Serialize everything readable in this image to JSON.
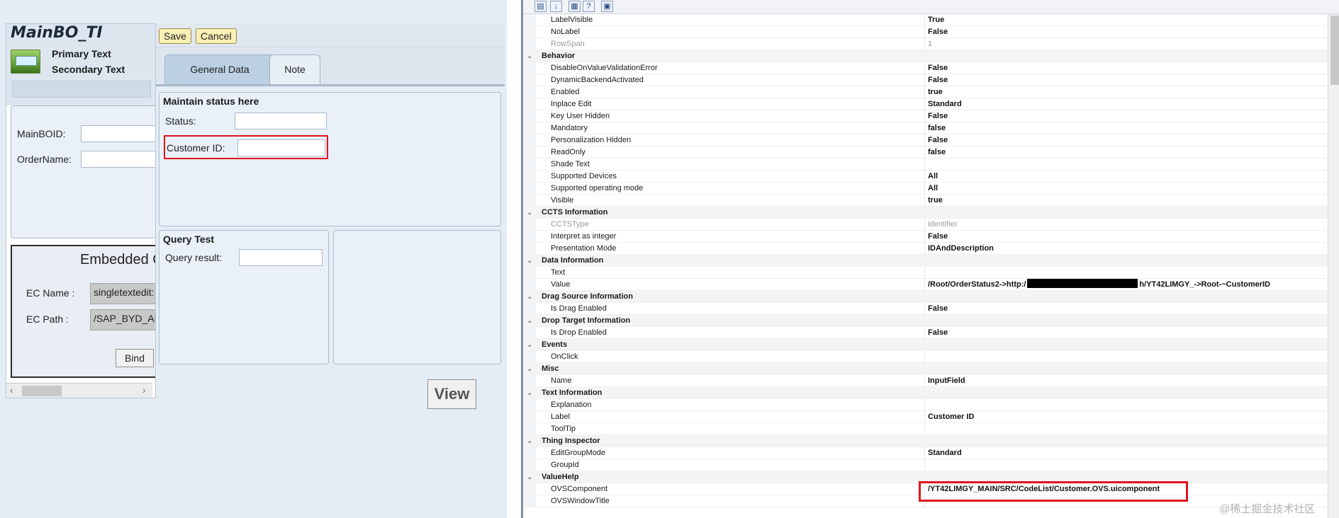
{
  "left_panel": {
    "title": "MainBO_TI",
    "primary_text": "Primary Text",
    "secondary_text": "Secondary Text",
    "fields": [
      {
        "label": "MainBOID:",
        "value": ""
      },
      {
        "label": "OrderName:",
        "value": ""
      }
    ],
    "embedded": {
      "title": "Embedded C",
      "ec_name_label": "EC Name :",
      "ec_name_value": "singletextedit:",
      "ec_path_label": "EC Path :",
      "ec_path_value": "/SAP_BYD_AP",
      "bind_label": "Bind"
    }
  },
  "toolbar": {
    "save_label": "Save",
    "cancel_label": "Cancel"
  },
  "tabs": [
    {
      "label": "General Data",
      "active": true
    },
    {
      "label": "Note",
      "active": false
    }
  ],
  "form": {
    "group1_title": "Maintain status here",
    "status_label": "Status:",
    "status_value": "",
    "customer_id_label": "Customer ID:",
    "customer_id_value": "",
    "query_group_title": "Query Test",
    "query_result_label": "Query result:",
    "query_result_value": "",
    "view_label": "View"
  },
  "property_grid": {
    "rows": [
      {
        "type": "prop",
        "name": "LabelVisible",
        "value": "True"
      },
      {
        "type": "prop",
        "name": "NoLabel",
        "value": "False"
      },
      {
        "type": "prop",
        "name": "RowSpan",
        "value": "1",
        "muted": true
      },
      {
        "type": "category",
        "name": "Behavior"
      },
      {
        "type": "prop",
        "name": "DisableOnValueValidationError",
        "value": "False"
      },
      {
        "type": "prop",
        "name": "DynamicBackendActivated",
        "value": "False"
      },
      {
        "type": "prop",
        "name": "Enabled",
        "value": "true"
      },
      {
        "type": "prop",
        "name": "Inplace Edit",
        "value": "Standard"
      },
      {
        "type": "prop",
        "name": "Key User Hidden",
        "value": "False"
      },
      {
        "type": "prop",
        "name": "Mandatory",
        "value": "false"
      },
      {
        "type": "prop",
        "name": "Personalization Hidden",
        "value": "False"
      },
      {
        "type": "prop",
        "name": "ReadOnly",
        "value": "false"
      },
      {
        "type": "prop",
        "name": "Shade Text",
        "value": ""
      },
      {
        "type": "prop",
        "name": "Supported Devices",
        "value": "All"
      },
      {
        "type": "prop",
        "name": "Supported operating mode",
        "value": "All"
      },
      {
        "type": "prop",
        "name": "Visible",
        "value": "true"
      },
      {
        "type": "category",
        "name": "CCTS Information"
      },
      {
        "type": "prop",
        "name": "CCTSType",
        "value": "identifier",
        "muted": true
      },
      {
        "type": "prop",
        "name": "Interpret as integer",
        "value": "False"
      },
      {
        "type": "prop",
        "name": "Presentation Mode",
        "value": "IDAndDescription"
      },
      {
        "type": "category",
        "name": "Data Information"
      },
      {
        "type": "prop",
        "name": "Text",
        "value": ""
      },
      {
        "type": "prop",
        "name": "Value",
        "value_prefix": "/Root/OrderStatus2->http:/",
        "value_suffix": "h/YT42LIMGY_->Root-~CustomerID",
        "redacted": true
      },
      {
        "type": "category",
        "name": "Drag Source Information"
      },
      {
        "type": "prop",
        "name": "Is Drag Enabled",
        "value": "False"
      },
      {
        "type": "category",
        "name": "Drop Target Information"
      },
      {
        "type": "prop",
        "name": "Is Drop Enabled",
        "value": "False"
      },
      {
        "type": "category",
        "name": "Events"
      },
      {
        "type": "prop",
        "name": "OnClick",
        "value": ""
      },
      {
        "type": "category",
        "name": "Misc"
      },
      {
        "type": "prop",
        "name": "Name",
        "value": "InputField"
      },
      {
        "type": "category",
        "name": "Text Information"
      },
      {
        "type": "prop",
        "name": "Explanation",
        "value": ""
      },
      {
        "type": "prop",
        "name": "Label",
        "value": "Customer ID"
      },
      {
        "type": "prop",
        "name": "ToolTip",
        "value": ""
      },
      {
        "type": "category",
        "name": "Thing Inspector"
      },
      {
        "type": "prop",
        "name": "EditGroupMode",
        "value": "Standard"
      },
      {
        "type": "prop",
        "name": "GroupId",
        "value": ""
      },
      {
        "type": "category",
        "name": "ValueHelp"
      },
      {
        "type": "prop",
        "name": "OVSComponent",
        "value": "/YT42LIMGY_MAIN/SRC/CodeList/Customer.OVS.uicomponent"
      },
      {
        "type": "prop",
        "name": "OVSWindowTitle",
        "value": ""
      }
    ]
  },
  "watermark": "@稀土掘金技术社区",
  "colors": {
    "highlight_red": "#e0141e",
    "button_yellow": "#f8efb4",
    "tab_active": "#bccfe3"
  }
}
